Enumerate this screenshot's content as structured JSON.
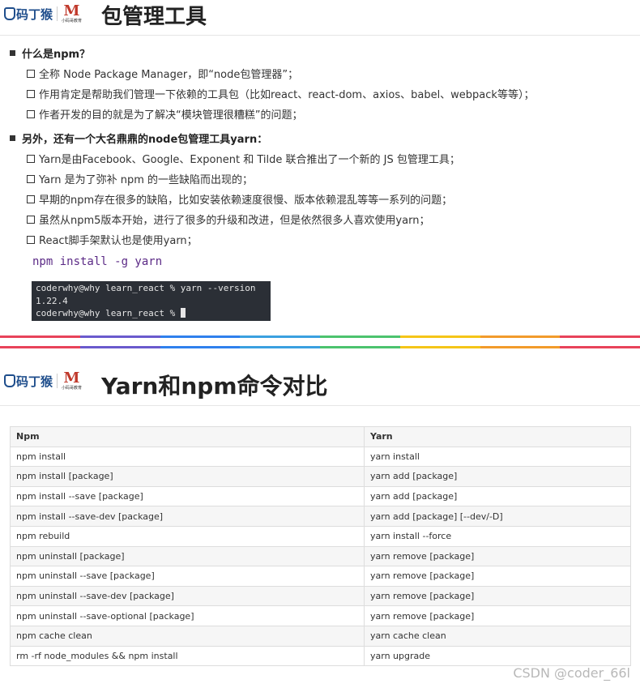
{
  "slide1": {
    "logo_left": "码丁猴",
    "logo_right_small": "小码哥教育",
    "title": "包管理工具",
    "sections": [
      {
        "heading": "什么是npm？",
        "items": [
          "全称 Node Package Manager，即“node包管理器”；",
          "作用肯定是帮助我们管理一下依赖的工具包（比如react、react-dom、axios、babel、webpack等等）；",
          "作者开发的目的就是为了解决“模块管理很糟糕”的问题；"
        ]
      },
      {
        "heading": "另外，还有一个大名鼎鼎的node包管理工具yarn：",
        "items": [
          "Yarn是由Facebook、Google、Exponent 和 Tilde 联合推出了一个新的 JS 包管理工具；",
          "Yarn 是为了弥补 npm 的一些缺陷而出现的；",
          "早期的npm存在很多的缺陷，比如安装依赖速度很慢、版本依赖混乱等等一系列的问题；",
          "虽然从npm5版本开始，进行了很多的升级和改进，但是依然很多人喜欢使用yarn；",
          "React脚手架默认也是使用yarn；"
        ]
      }
    ],
    "code": "npm install -g yarn",
    "terminal": {
      "line1": "coderwhy@why learn_react % yarn --version",
      "line2": "1.22.4",
      "line3": "coderwhy@why learn_react % "
    }
  },
  "divider_colors": [
    "#e8435a",
    "#6a5acd",
    "#2f80ed",
    "#3aa0e0",
    "#4cc36e",
    "#f5c518",
    "#f29b2b",
    "#e8435a"
  ],
  "slide2": {
    "logo_left": "码丁猴",
    "logo_right_small": "小码哥教育",
    "title": "Yarn和npm命令对比",
    "table": {
      "headers": [
        "Npm",
        "Yarn"
      ],
      "rows": [
        [
          "npm install",
          "yarn install"
        ],
        [
          "npm install [package]",
          "yarn add [package]"
        ],
        [
          "npm install --save [package]",
          "yarn add [package]"
        ],
        [
          "npm install --save-dev [package]",
          "yarn add [package] [--dev/-D]"
        ],
        [
          "npm rebuild",
          "yarn install --force"
        ],
        [
          "npm uninstall [package]",
          "yarn remove [package]"
        ],
        [
          "npm uninstall --save [package]",
          "yarn remove [package]"
        ],
        [
          "npm uninstall --save-dev [package]",
          "yarn remove [package]"
        ],
        [
          "npm uninstall --save-optional [package]",
          "yarn remove [package]"
        ],
        [
          "npm cache clean",
          "yarn cache clean"
        ],
        [
          "rm -rf node_modules && npm install",
          "yarn upgrade"
        ]
      ]
    }
  },
  "watermark": "CSDN @coder_66l"
}
